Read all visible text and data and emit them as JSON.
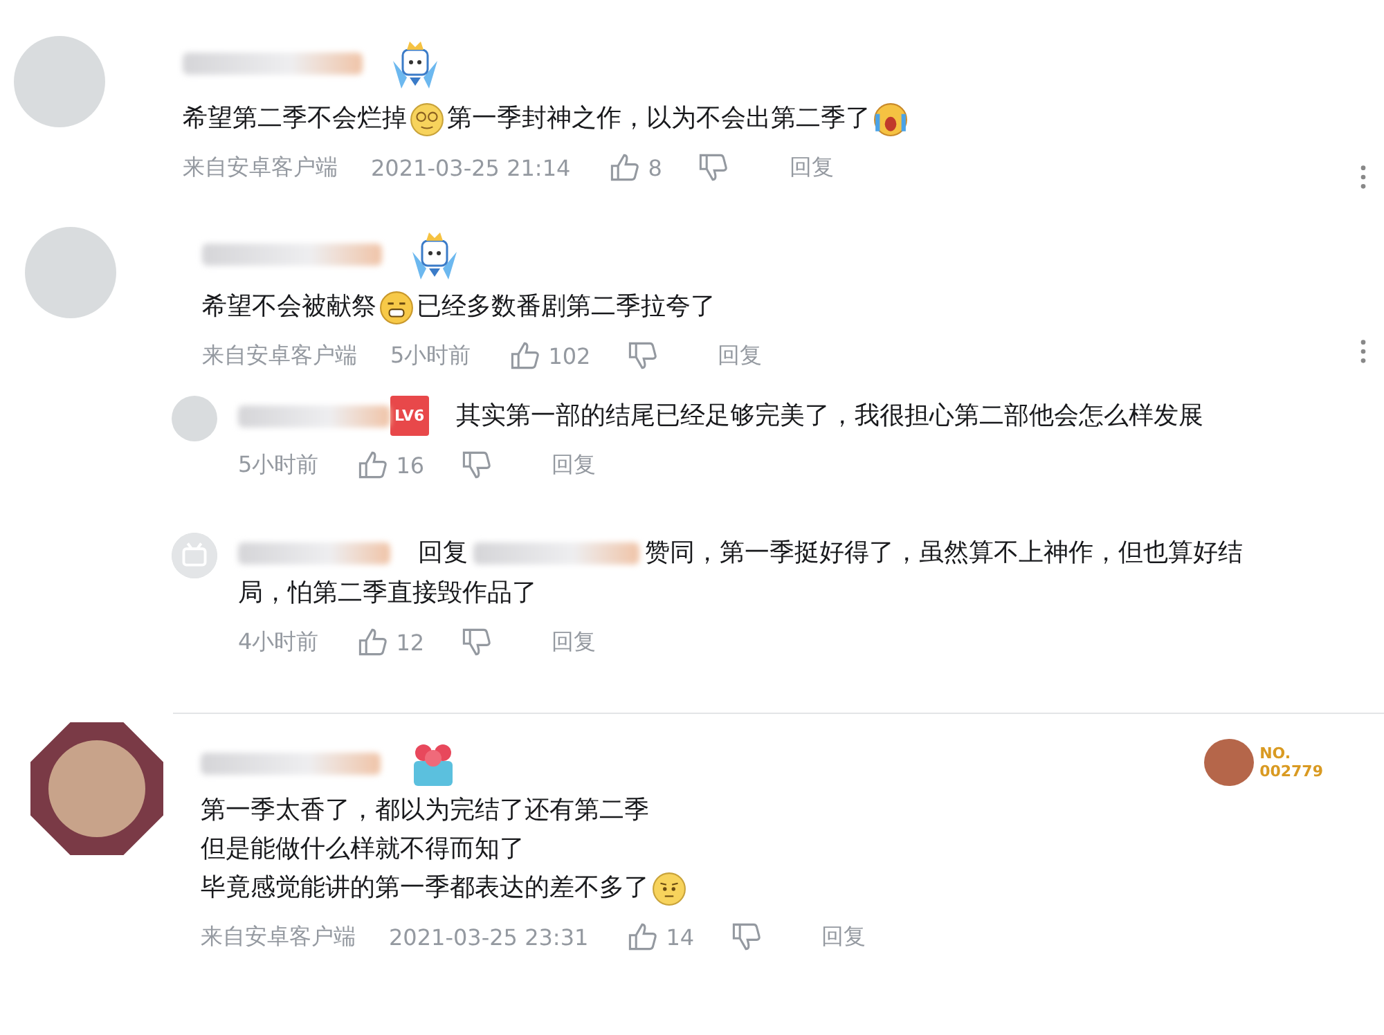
{
  "comments": [
    {
      "avatar": {
        "kind": "photo"
      },
      "badge": {
        "kind": "mascot"
      },
      "lines": [
        [
          {
            "kind": "text",
            "text": "希望第二季不会烂掉"
          },
          {
            "kind": "emoji-dizzy"
          },
          {
            "kind": "text",
            "text": "第一季封神之作，以为不会出第二季了"
          },
          {
            "kind": "emoji-cry"
          }
        ]
      ],
      "source": "来自安卓客户端",
      "time": "2021-03-25 21:14",
      "likes": "8",
      "reply_label": "回复"
    },
    {
      "avatar": {
        "kind": "photo"
      },
      "badge": {
        "kind": "mascot"
      },
      "lines": [
        [
          {
            "kind": "text",
            "text": "希望不会被献祭"
          },
          {
            "kind": "emoji-grin"
          },
          {
            "kind": "text",
            "text": "已经多数番剧第二季拉夸了"
          }
        ]
      ],
      "source": "来自安卓客户端",
      "time": "5小时前",
      "likes": "102",
      "reply_label": "回复",
      "replies": [
        {
          "avatar": {
            "kind": "photo"
          },
          "level": "LV6",
          "lines": [
            "其实第一部的结尾已经足够完美了，我很担心第二部他会怎么样发展"
          ],
          "time": "5小时前",
          "likes": "16",
          "reply_label": "回复"
        },
        {
          "avatar": {
            "kind": "default"
          },
          "prefix": "回复",
          "lines": [
            "赞同，第一季挺好得了，虽然算不上神作，但也算好结",
            "局，怕第二季直接毁作品了"
          ],
          "time": "4小时前",
          "likes": "12",
          "reply_label": "回复"
        }
      ]
    },
    {
      "avatar": {
        "kind": "frame"
      },
      "badge": {
        "kind": "gift"
      },
      "fan_badge": {
        "label": "NO.",
        "number": "002779"
      },
      "lines": [
        [
          {
            "kind": "text",
            "text": "第一季太香了，都以为完结了还有第二季"
          }
        ],
        [
          {
            "kind": "text",
            "text": "但是能做什么样就不得而知了"
          }
        ],
        [
          {
            "kind": "text",
            "text": "毕竟感觉能讲的第一季都表达的差不多了"
          },
          {
            "kind": "emoji-doubt"
          }
        ]
      ],
      "source": "来自安卓客户端",
      "time": "2021-03-25 23:31",
      "likes": "14",
      "reply_label": "回复"
    }
  ]
}
